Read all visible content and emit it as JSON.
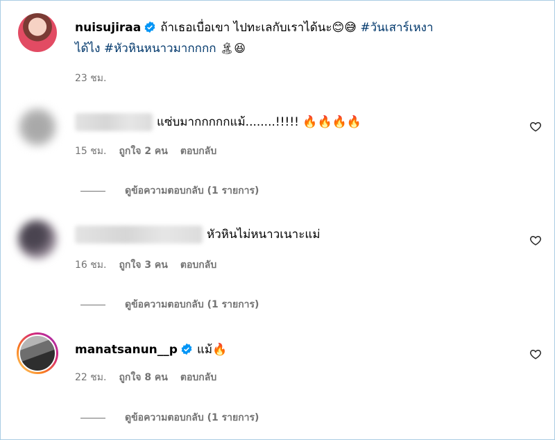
{
  "post": {
    "username": "nuisujiraa",
    "caption": "ถ้าเธอเบื่อเขา ไปทะเลกับเราได้นะ😊😅 ",
    "hashtag1": "#วันเสาร์เหงา",
    "caption_line2_prefix": "ได้ไง ",
    "hashtag2": "#หัวหินหนาวมากกกก",
    "caption_emojis": "🏝😆",
    "time": "23 ชม."
  },
  "comments": [
    {
      "text": "แซ่บมากกกกกแม้........!!!!! 🔥🔥🔥🔥",
      "time": "15 ชม.",
      "likes": "ถูกใจ 2 คน",
      "reply": "ตอบกลับ",
      "view_replies": "ดูข้อความตอบกลับ (1 รายการ)"
    },
    {
      "text": "หัวหินไม่หนาวเนาะแม่",
      "time": "16 ชม.",
      "likes": "ถูกใจ 3 คน",
      "reply": "ตอบกลับ",
      "view_replies": "ดูข้อความตอบกลับ (1 รายการ)"
    },
    {
      "username": "manatsanun__p",
      "text": "แม้🔥",
      "time": "22 ชม.",
      "likes": "ถูกใจ 8 คน",
      "reply": "ตอบกลับ",
      "view_replies": "ดูข้อความตอบกลับ (1 รายการ)"
    }
  ],
  "colors": {
    "verified": "#0095f6",
    "hashtag": "#00376b",
    "meta": "#737373"
  },
  "icons": [
    "verified-badge-icon",
    "heart-outline-icon"
  ]
}
